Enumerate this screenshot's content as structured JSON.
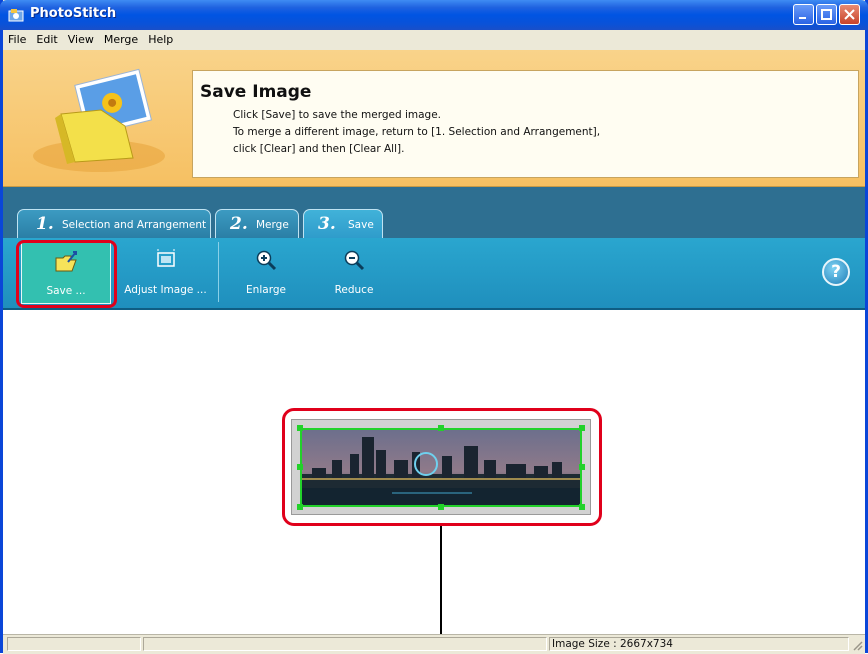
{
  "window": {
    "title": "PhotoStitch"
  },
  "menu": [
    "File",
    "Edit",
    "View",
    "Merge",
    "Help"
  ],
  "banner": {
    "heading": "Save Image",
    "lines": [
      "Click [Save] to save the merged image.",
      "To merge a different image, return to [1. Selection and Arrangement],",
      "click [Clear] and then [Clear All]."
    ]
  },
  "tabs": [
    {
      "num": "1.",
      "label": "Selection and Arrangement",
      "active": false
    },
    {
      "num": "2.",
      "label": "Merge",
      "active": false
    },
    {
      "num": "3.",
      "label": "Save",
      "active": true
    }
  ],
  "toolbar": {
    "save": "Save ...",
    "adjust": "Adjust Image ...",
    "enlarge": "Enlarge",
    "reduce": "Reduce",
    "help": "?"
  },
  "status": {
    "image_size": "Image Size : 2667x734"
  },
  "colors": {
    "titlebar": "#0054e3",
    "tab_area": "#2e6f91",
    "toolbar": "#1f8fbd",
    "highlight": "#e0001b",
    "selection": "#22d22a"
  }
}
